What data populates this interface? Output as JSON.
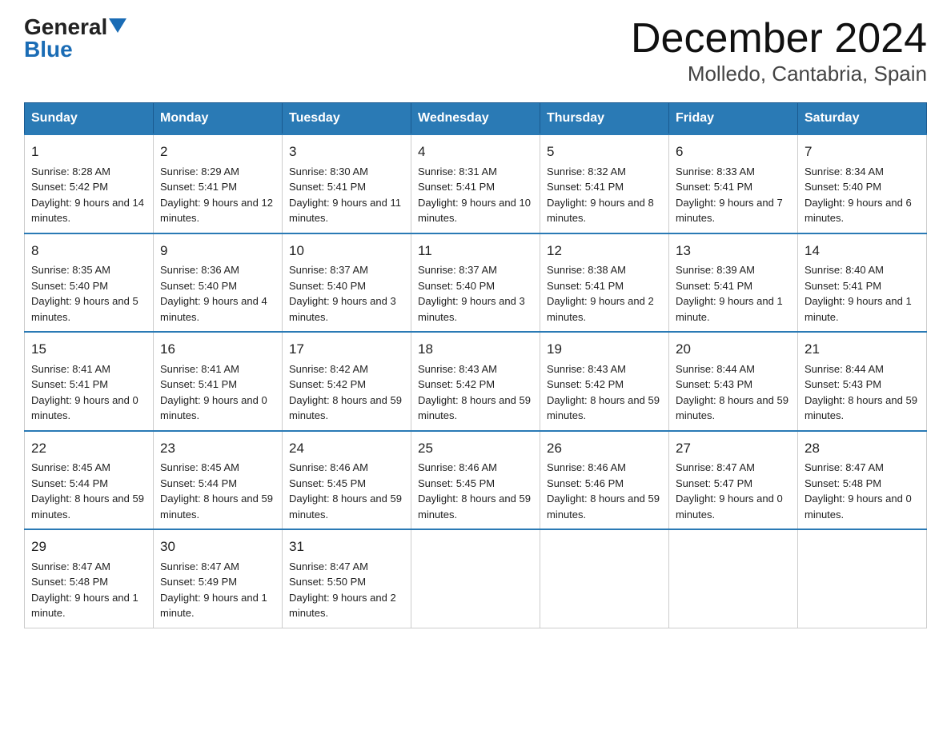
{
  "logo": {
    "general": "General",
    "blue": "Blue"
  },
  "title": "December 2024",
  "subtitle": "Molledo, Cantabria, Spain",
  "days_header": [
    "Sunday",
    "Monday",
    "Tuesday",
    "Wednesday",
    "Thursday",
    "Friday",
    "Saturday"
  ],
  "weeks": [
    [
      {
        "day": "1",
        "sunrise": "8:28 AM",
        "sunset": "5:42 PM",
        "daylight": "9 hours and 14 minutes."
      },
      {
        "day": "2",
        "sunrise": "8:29 AM",
        "sunset": "5:41 PM",
        "daylight": "9 hours and 12 minutes."
      },
      {
        "day": "3",
        "sunrise": "8:30 AM",
        "sunset": "5:41 PM",
        "daylight": "9 hours and 11 minutes."
      },
      {
        "day": "4",
        "sunrise": "8:31 AM",
        "sunset": "5:41 PM",
        "daylight": "9 hours and 10 minutes."
      },
      {
        "day": "5",
        "sunrise": "8:32 AM",
        "sunset": "5:41 PM",
        "daylight": "9 hours and 8 minutes."
      },
      {
        "day": "6",
        "sunrise": "8:33 AM",
        "sunset": "5:41 PM",
        "daylight": "9 hours and 7 minutes."
      },
      {
        "day": "7",
        "sunrise": "8:34 AM",
        "sunset": "5:40 PM",
        "daylight": "9 hours and 6 minutes."
      }
    ],
    [
      {
        "day": "8",
        "sunrise": "8:35 AM",
        "sunset": "5:40 PM",
        "daylight": "9 hours and 5 minutes."
      },
      {
        "day": "9",
        "sunrise": "8:36 AM",
        "sunset": "5:40 PM",
        "daylight": "9 hours and 4 minutes."
      },
      {
        "day": "10",
        "sunrise": "8:37 AM",
        "sunset": "5:40 PM",
        "daylight": "9 hours and 3 minutes."
      },
      {
        "day": "11",
        "sunrise": "8:37 AM",
        "sunset": "5:40 PM",
        "daylight": "9 hours and 3 minutes."
      },
      {
        "day": "12",
        "sunrise": "8:38 AM",
        "sunset": "5:41 PM",
        "daylight": "9 hours and 2 minutes."
      },
      {
        "day": "13",
        "sunrise": "8:39 AM",
        "sunset": "5:41 PM",
        "daylight": "9 hours and 1 minute."
      },
      {
        "day": "14",
        "sunrise": "8:40 AM",
        "sunset": "5:41 PM",
        "daylight": "9 hours and 1 minute."
      }
    ],
    [
      {
        "day": "15",
        "sunrise": "8:41 AM",
        "sunset": "5:41 PM",
        "daylight": "9 hours and 0 minutes."
      },
      {
        "day": "16",
        "sunrise": "8:41 AM",
        "sunset": "5:41 PM",
        "daylight": "9 hours and 0 minutes."
      },
      {
        "day": "17",
        "sunrise": "8:42 AM",
        "sunset": "5:42 PM",
        "daylight": "8 hours and 59 minutes."
      },
      {
        "day": "18",
        "sunrise": "8:43 AM",
        "sunset": "5:42 PM",
        "daylight": "8 hours and 59 minutes."
      },
      {
        "day": "19",
        "sunrise": "8:43 AM",
        "sunset": "5:42 PM",
        "daylight": "8 hours and 59 minutes."
      },
      {
        "day": "20",
        "sunrise": "8:44 AM",
        "sunset": "5:43 PM",
        "daylight": "8 hours and 59 minutes."
      },
      {
        "day": "21",
        "sunrise": "8:44 AM",
        "sunset": "5:43 PM",
        "daylight": "8 hours and 59 minutes."
      }
    ],
    [
      {
        "day": "22",
        "sunrise": "8:45 AM",
        "sunset": "5:44 PM",
        "daylight": "8 hours and 59 minutes."
      },
      {
        "day": "23",
        "sunrise": "8:45 AM",
        "sunset": "5:44 PM",
        "daylight": "8 hours and 59 minutes."
      },
      {
        "day": "24",
        "sunrise": "8:46 AM",
        "sunset": "5:45 PM",
        "daylight": "8 hours and 59 minutes."
      },
      {
        "day": "25",
        "sunrise": "8:46 AM",
        "sunset": "5:45 PM",
        "daylight": "8 hours and 59 minutes."
      },
      {
        "day": "26",
        "sunrise": "8:46 AM",
        "sunset": "5:46 PM",
        "daylight": "8 hours and 59 minutes."
      },
      {
        "day": "27",
        "sunrise": "8:47 AM",
        "sunset": "5:47 PM",
        "daylight": "9 hours and 0 minutes."
      },
      {
        "day": "28",
        "sunrise": "8:47 AM",
        "sunset": "5:48 PM",
        "daylight": "9 hours and 0 minutes."
      }
    ],
    [
      {
        "day": "29",
        "sunrise": "8:47 AM",
        "sunset": "5:48 PM",
        "daylight": "9 hours and 1 minute."
      },
      {
        "day": "30",
        "sunrise": "8:47 AM",
        "sunset": "5:49 PM",
        "daylight": "9 hours and 1 minute."
      },
      {
        "day": "31",
        "sunrise": "8:47 AM",
        "sunset": "5:50 PM",
        "daylight": "9 hours and 2 minutes."
      },
      null,
      null,
      null,
      null
    ]
  ]
}
